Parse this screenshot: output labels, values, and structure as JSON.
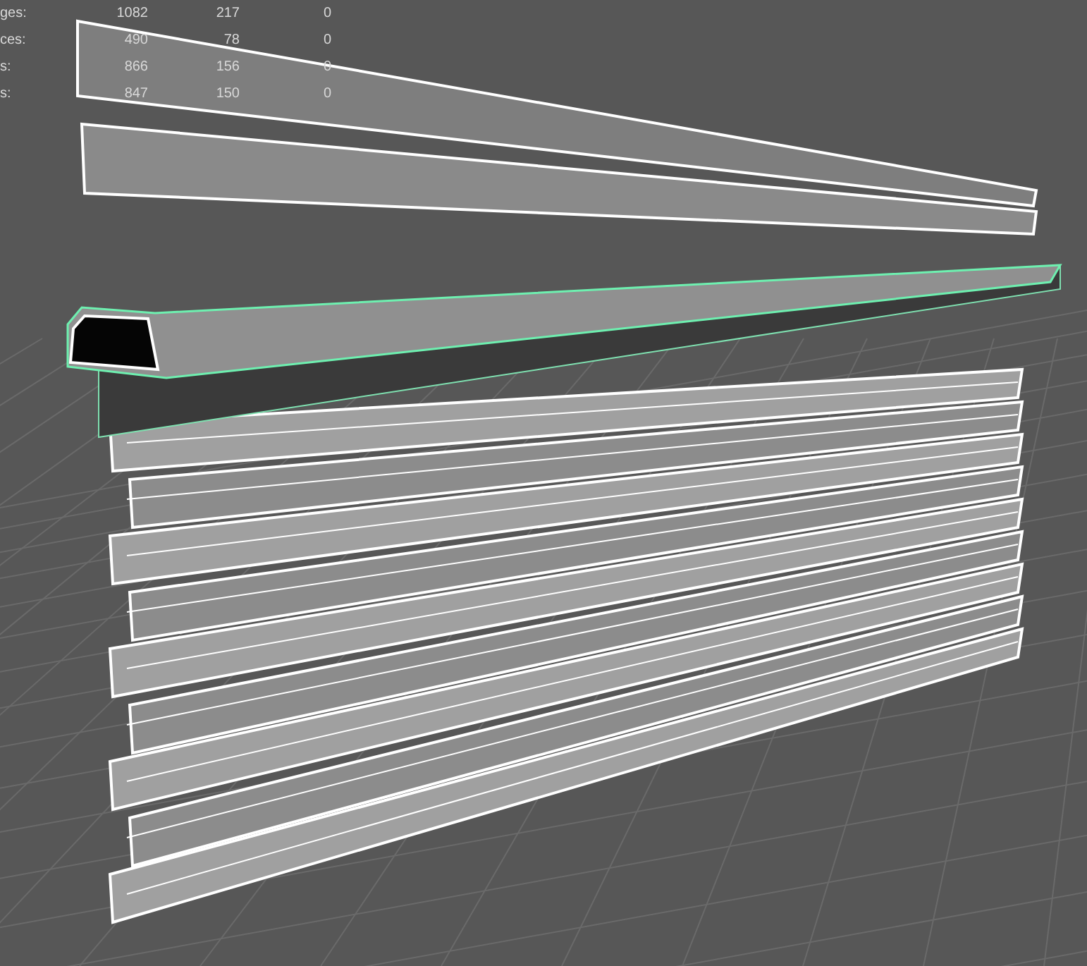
{
  "hud": {
    "rows": [
      {
        "label": "ges:",
        "values": [
          "1082",
          "217",
          "0"
        ]
      },
      {
        "label": "ces:",
        "values": [
          "490",
          "78",
          "0"
        ]
      },
      {
        "label": "s:",
        "values": [
          "866",
          "156",
          "0"
        ]
      },
      {
        "label": "s:",
        "values": [
          "847",
          "150",
          "0"
        ]
      }
    ]
  }
}
